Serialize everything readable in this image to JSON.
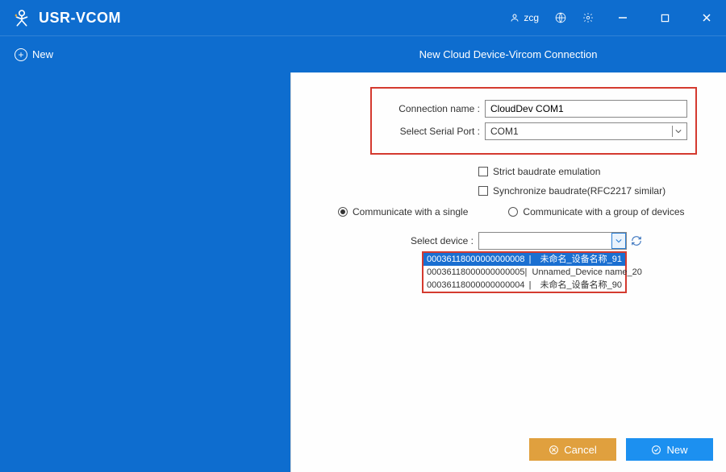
{
  "titlebar": {
    "app_name": "USR-VCOM",
    "user": "zcg"
  },
  "toolbar": {
    "new_label": "New",
    "panel_title": "New Cloud Device-Vircom Connection"
  },
  "form": {
    "conn_name_label": "Connection name :",
    "conn_name_value": "CloudDev COM1",
    "serial_port_label": "Select Serial Port :",
    "serial_port_value": "COM1",
    "strict_label": "Strict baudrate emulation",
    "sync_label": "Synchronize baudrate(RFC2217 similar)",
    "radio_single": "Communicate with a single",
    "radio_group": "Communicate with a group of devices",
    "select_device_label": "Select device :",
    "devices": [
      {
        "id": "00036118000000000008",
        "name": "未命名_设备名称_91"
      },
      {
        "id": "00036118000000000005",
        "name": "Unnamed_Device name_20"
      },
      {
        "id": "00036118000000000004",
        "name": "未命名_设备名称_90"
      }
    ],
    "selected_device_index": 0
  },
  "footer": {
    "cancel": "Cancel",
    "new": "New"
  }
}
